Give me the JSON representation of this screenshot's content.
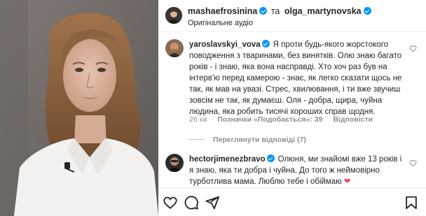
{
  "header": {
    "author": "mashaefrosinina",
    "connector": "та",
    "coauthor": "olga_martynovska",
    "audio": "Оригінальне аудіо"
  },
  "comments": [
    {
      "username": "yaroslavskyi_vova",
      "verified": true,
      "text": "Я проти будь-якого жорстокого поводження з тваринами, без винятків. Олю знаю багато років - і знаю, яка вона насправді. Хто хоч раз був на інтерв'ю перед камерою - знає, як легко сказати щось не так, як мав на увазі. Стрес, хвилювання, і ти вже звучиш зовсім не так, як думаєш. Оля - добра, щира, чуйна людина, яка робить тисячі хороших справ щодня.",
      "time": "26 хв",
      "likes": "Позначки «Подобається»: 39",
      "reply": "Відповісти",
      "view_replies": "Переглянути відповіді (7)"
    },
    {
      "username": "hectorjimenezbravo",
      "verified": true,
      "text": "Олюня, ми знайомі вже 13 років і я знаю, яка ти добра і чуйна. До того ж неймовірно турботлива мама. Люблю тебе і обіймаю ❤"
    }
  ],
  "icons": {
    "like": "heart-icon",
    "comment": "comment-icon",
    "share": "share-icon",
    "save": "bookmark-icon"
  },
  "colors": {
    "verified": "#0095f6",
    "emoji_heart": "#ed4956",
    "muted": "#8e8e8e"
  }
}
